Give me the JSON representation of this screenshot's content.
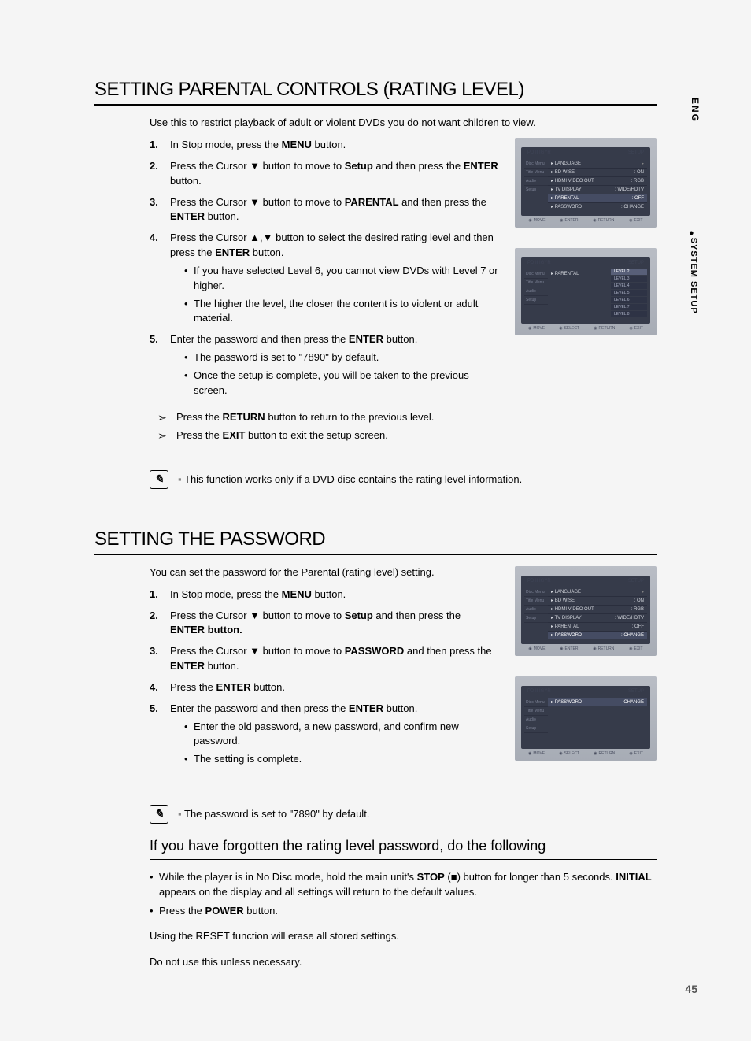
{
  "sideTabs": {
    "lang": "ENG",
    "section": "SYSTEM SETUP"
  },
  "pageNumber": "45",
  "section1": {
    "title": "SETTING PARENTAL CONTROLS (RATING LEVEL)",
    "intro": "Use this to restrict playback of adult or violent DVDs you do not want children to view.",
    "steps": {
      "s1": "In Stop mode, press the MENU button.",
      "s2": "Press the Cursor ▼ button to move to Setup and then press the ENTER button.",
      "s3": "Press the Cursor ▼ button to move to PARENTAL and then press the ENTER button.",
      "s4": "Press the Cursor ▲,▼ button to select the desired rating level and then press the ENTER button.",
      "s4_b1": "If you have selected Level 6, you cannot view DVDs with Level 7 or higher.",
      "s4_b2": "The higher the level, the closer the content is to violent or adult material.",
      "s5": "Enter the password and then press the ENTER button.",
      "s5_b1": "The password is set to \"7890\" by default.",
      "s5_b2": "Once the setup is complete, you will be taken to the previous screen."
    },
    "press1": "Press the RETURN button to return to the previous level.",
    "press2": "Press the EXIT button to exit the setup screen.",
    "note": "This function works only if a DVD disc contains the rating level information."
  },
  "section2": {
    "title": "SETTING THE PASSWORD",
    "intro": "You can set the password for the Parental (rating level) setting.",
    "steps": {
      "s1": "In Stop mode, press the MENU button.",
      "s2_a": "Press the Cursor ▼ button to move to Setup and then press the",
      "s2_b": "ENTER button.",
      "s3": "Press the Cursor ▼ button to move to PASSWORD and then press the ENTER button.",
      "s4": "Press the ENTER button.",
      "s5": "Enter the password and then press the ENTER button.",
      "s5_b1": "Enter the old password, a new password, and confirm new password.",
      "s5_b2": "The setting is complete."
    },
    "note": "The password is set to \"7890\" by default.",
    "forgotTitle": "If you have forgotten the rating level password, do the following",
    "forgot_b1": "While the player is in No Disc mode, hold the main unit's STOP (■) button for longer than 5 seconds. INITIAL appears on the display and all settings will return to the default values.",
    "forgot_b2": "Press the POWER button.",
    "closing1": "Using the RESET function will erase all stored settings.",
    "closing2": "Do not use this unless necessary."
  },
  "osd": {
    "headerLeft": "PD II IGYR",
    "headerRight": "SETUP",
    "leftTabs": [
      "Disc Menu",
      "Title Menu",
      "Audio",
      "Setup"
    ],
    "footer": {
      "move": "MOVE",
      "enter": "ENTER",
      "select": "SELECT",
      "return": "RETURN",
      "exit": "EXIT"
    },
    "screen1": {
      "rows": [
        {
          "label": "LANGUAGE",
          "value": ""
        },
        {
          "label": "BD WISE",
          "value": ": ON"
        },
        {
          "label": "HDMI VIDEO OUT",
          "value": ": RGB"
        },
        {
          "label": "TV DISPLAY",
          "value": ": WIDE/HDTV"
        },
        {
          "label": "PARENTAL",
          "value": ": OFF",
          "hl": true
        },
        {
          "label": "PASSWORD",
          "value": ": CHANGE"
        }
      ]
    },
    "screen2": {
      "rowLabel": "PARENTAL",
      "levels": [
        "LEVEL 2",
        "LEVEL 3",
        "LEVEL 4",
        "LEVEL 5",
        "LEVEL 6",
        "LEVEL 7",
        "LEVEL 8"
      ]
    },
    "screen3": {
      "rows": [
        {
          "label": "LANGUAGE",
          "value": ""
        },
        {
          "label": "BD WISE",
          "value": ": ON"
        },
        {
          "label": "HDMI VIDEO OUT",
          "value": ": RGB"
        },
        {
          "label": "TV DISPLAY",
          "value": ": WIDE/HDTV"
        },
        {
          "label": "PARENTAL",
          "value": ": OFF"
        },
        {
          "label": "PASSWORD",
          "value": ": CHANGE",
          "hl": true
        }
      ]
    },
    "screen4": {
      "rowLabel": "PASSWORD",
      "rowValue": "CHANGE"
    }
  }
}
